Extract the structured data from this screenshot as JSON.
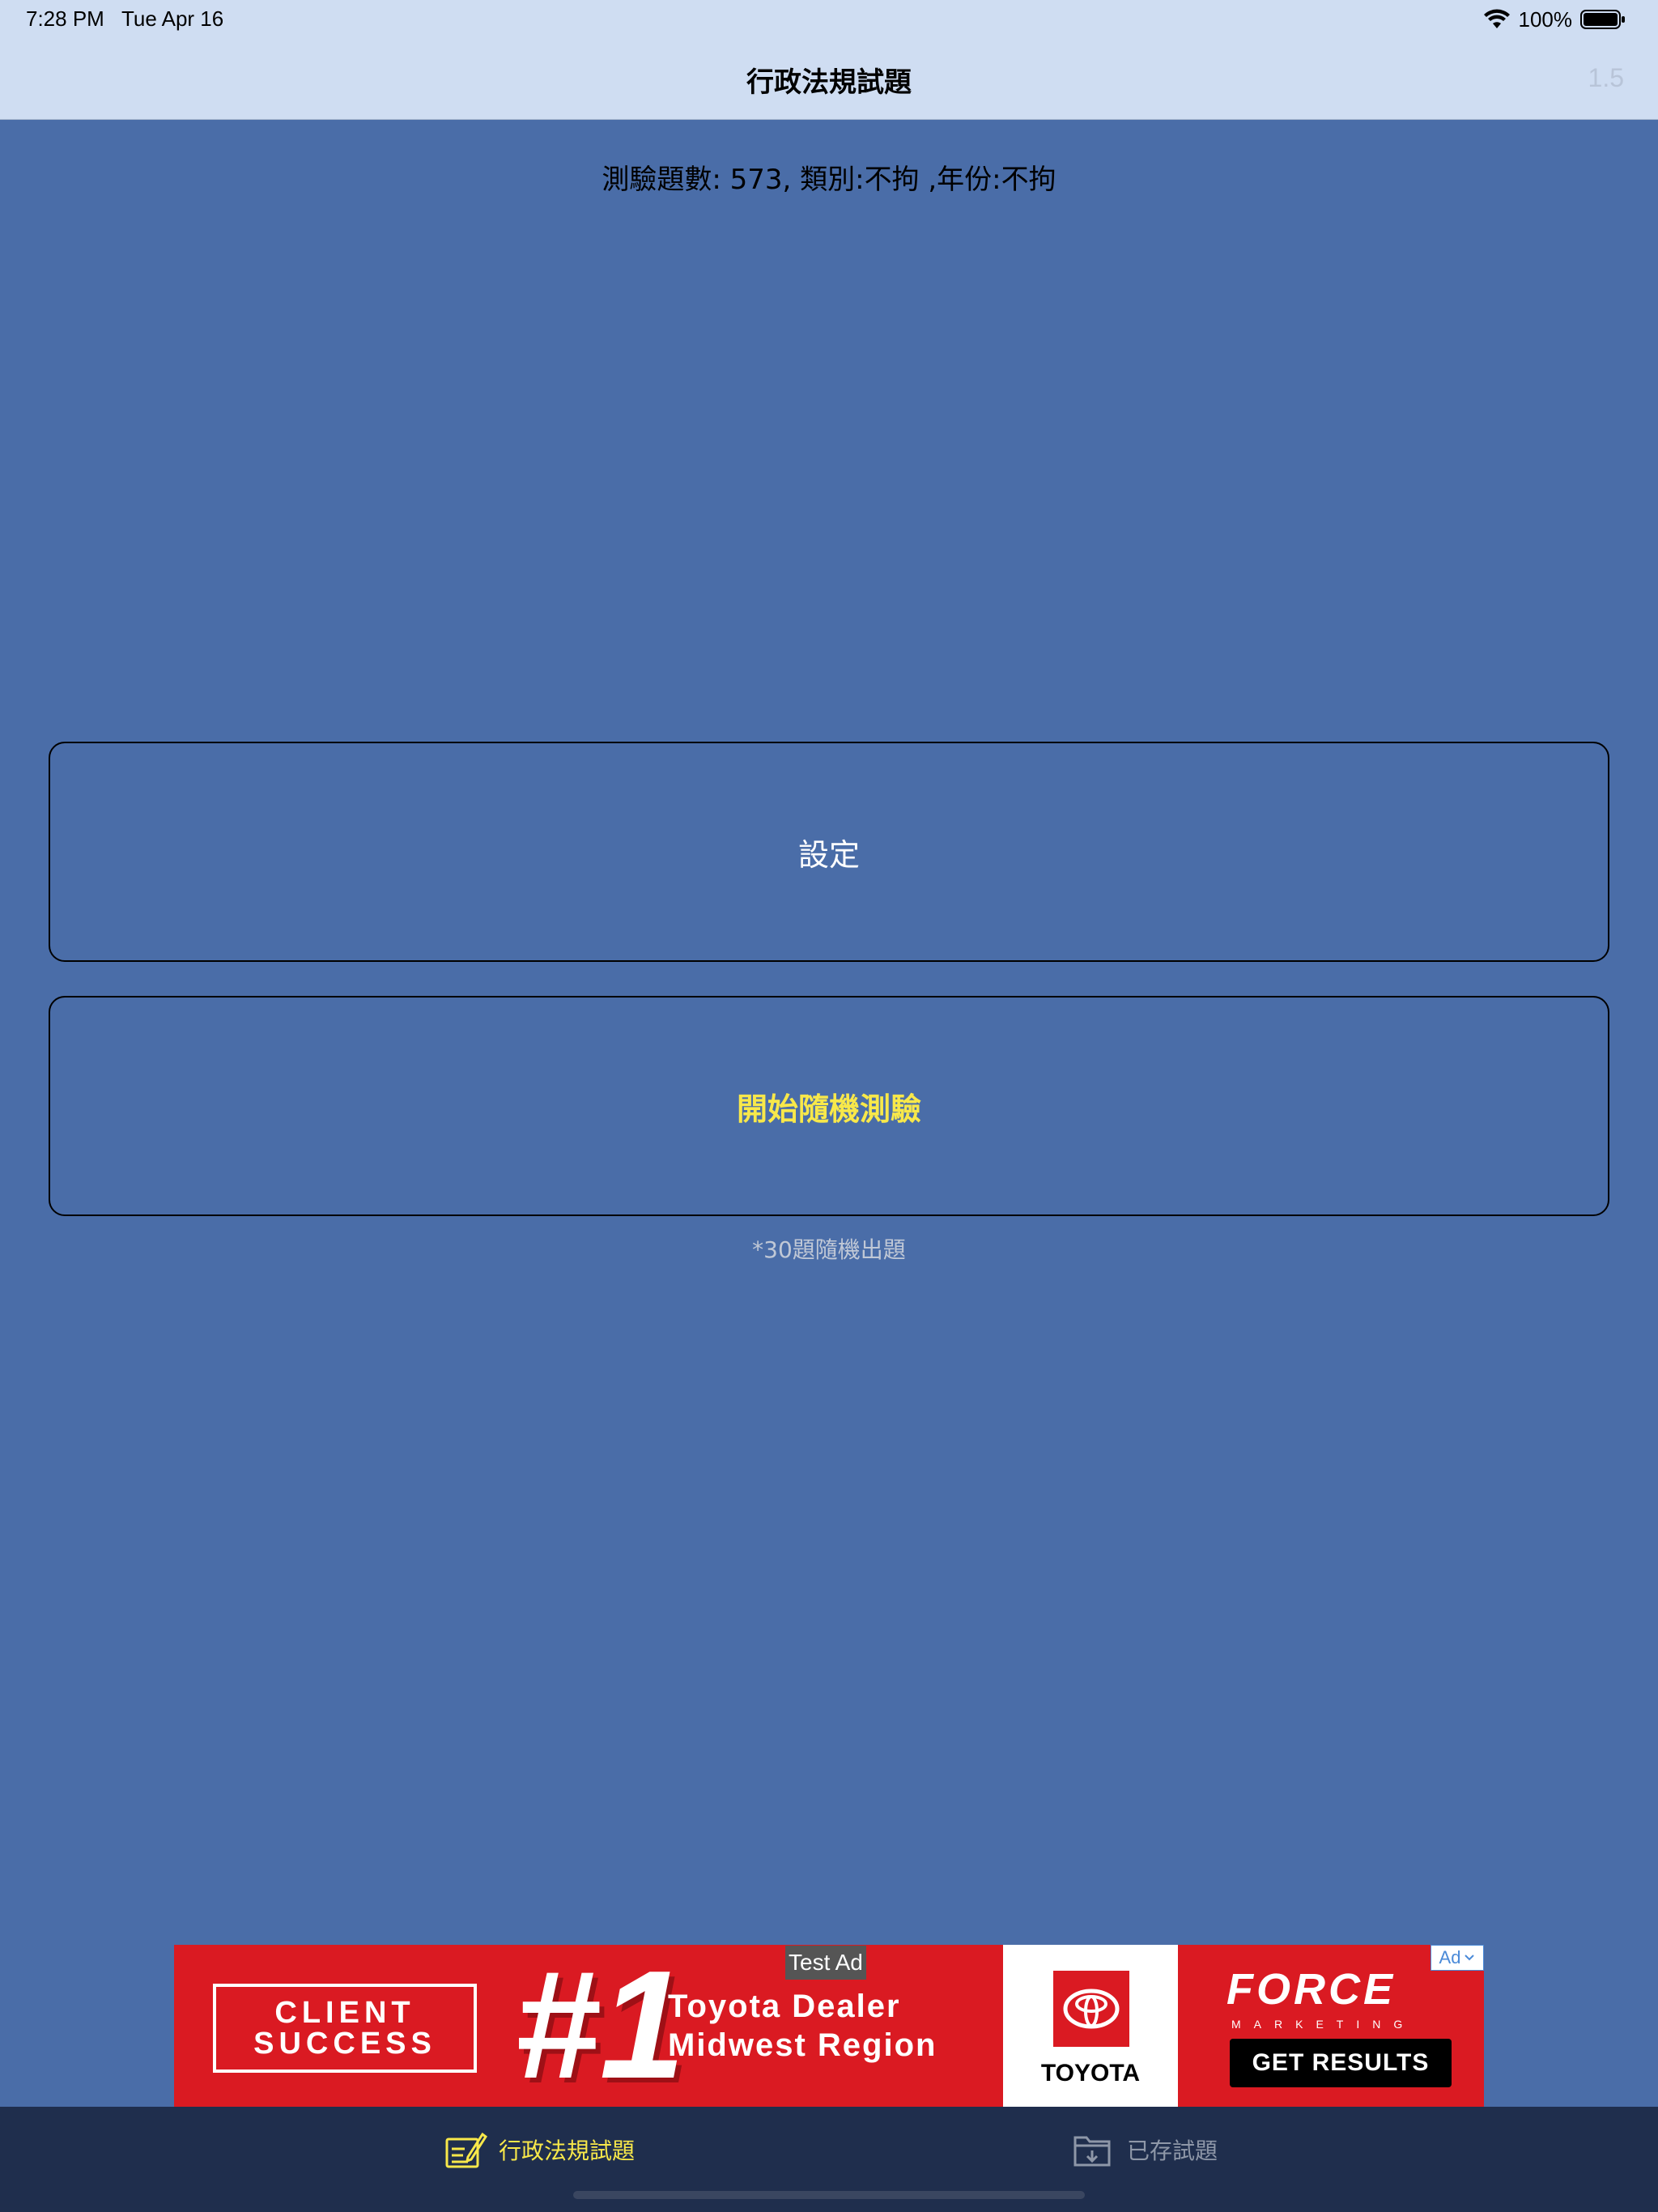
{
  "status_bar": {
    "time": "7:28 PM",
    "date": "Tue Apr 16",
    "battery": "100%"
  },
  "nav": {
    "title": "行政法規試題",
    "version": "1.5"
  },
  "summary": "測驗題數: 573, 類別:不拘 ,年份:不拘",
  "buttons": {
    "settings": "設定",
    "start": "開始隨機測驗"
  },
  "hint": "*30題隨機出題",
  "ad": {
    "test_label": "Test Ad",
    "badge": "Ad",
    "client_success": "CLIENT\nSUCCESS",
    "number": "#1",
    "headline": "Toyota Dealer\nMidwest Region",
    "toyota": "TOYOTA",
    "force": "FORCE",
    "force_sub": "MARKETING",
    "cta": "GET RESULTS"
  },
  "tabs": {
    "quiz": "行政法規試題",
    "saved": "已存試題"
  },
  "colors": {
    "background": "#4a6da8",
    "nav": "#cfddf2",
    "accent_yellow": "#f8e84a",
    "tab_bar": "#1f2e4d",
    "ad_red": "#da1a22"
  }
}
